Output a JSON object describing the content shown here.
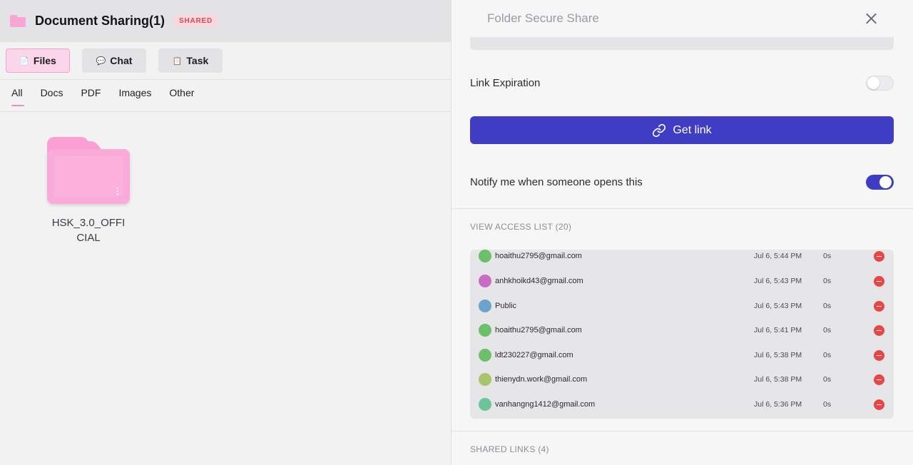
{
  "app": {
    "title": "Document Sharing(1)",
    "badge": "SHARED",
    "modes": [
      {
        "label": "Files",
        "icon": "file-icon",
        "glyph": "📄"
      },
      {
        "label": "Chat",
        "icon": "speech-bubble-icon",
        "glyph": "💬"
      },
      {
        "label": "Task",
        "icon": "clipboard-icon",
        "glyph": "📋"
      }
    ],
    "filters": [
      "All",
      "Docs",
      "PDF",
      "Images",
      "Other"
    ],
    "files": [
      {
        "name": "HSK_3.0_OFFICIAL"
      }
    ],
    "colors": {
      "folder": "#fbabda",
      "accent": "#ef8cc0"
    }
  },
  "panel": {
    "title": "Folder Secure Share",
    "link_expiration_label": "Link Expiration",
    "link_expiration_enabled": false,
    "get_link_label": "Get link",
    "notify_label": "Notify me when someone opens this",
    "notify_enabled": true,
    "access_list_title": "VIEW ACCESS LIST (20)",
    "shared_links_title": "SHARED LINKS (4)",
    "access_list": [
      {
        "email": "hoaithu2795@gmail.com",
        "date": "Jul 6, 5:44 PM",
        "duration": "0s",
        "avatar_color": "#6cc06a"
      },
      {
        "email": "anhkhoikd43@gmail.com",
        "date": "Jul 6, 5:43 PM",
        "duration": "0s",
        "avatar_color": "#c96cc6"
      },
      {
        "email": "Public",
        "date": "Jul 6, 5:43 PM",
        "duration": "0s",
        "avatar_color": "#6ba3cf"
      },
      {
        "email": "hoaithu2795@gmail.com",
        "date": "Jul 6, 5:41 PM",
        "duration": "0s",
        "avatar_color": "#6cc06a"
      },
      {
        "email": "ldt230227@gmail.com",
        "date": "Jul 6, 5:38 PM",
        "duration": "0s",
        "avatar_color": "#6cc06a"
      },
      {
        "email": "thienydn.work@gmail.com",
        "date": "Jul 6, 5:38 PM",
        "duration": "0s",
        "avatar_color": "#a9c46a"
      },
      {
        "email": "vanhangng1412@gmail.com",
        "date": "Jul 6, 5:36 PM",
        "duration": "0s",
        "avatar_color": "#6cc49a"
      }
    ],
    "colors": {
      "primary": "#3f3dc4",
      "remove": "#e64646"
    }
  }
}
